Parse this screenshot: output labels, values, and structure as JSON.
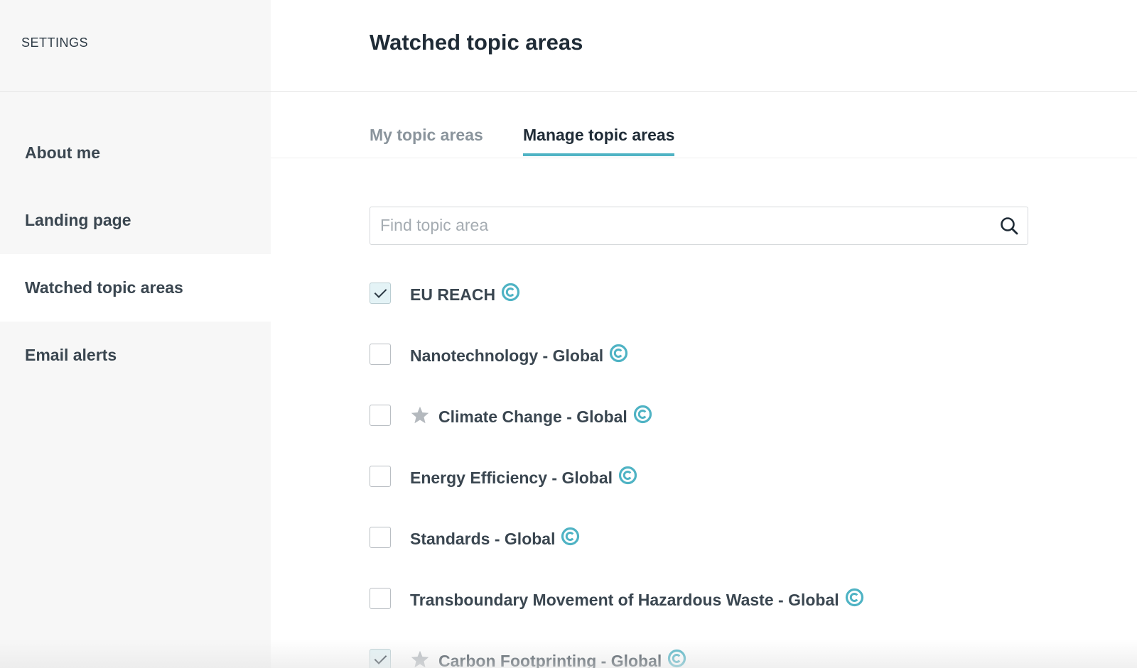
{
  "sidebar": {
    "header": "SETTINGS",
    "items": [
      {
        "label": "About me",
        "active": false
      },
      {
        "label": "Landing page",
        "active": false
      },
      {
        "label": "Watched topic areas",
        "active": true
      },
      {
        "label": "Email alerts",
        "active": false
      }
    ]
  },
  "main": {
    "title": "Watched topic areas",
    "tabs": [
      {
        "label": "My topic areas",
        "active": false
      },
      {
        "label": "Manage topic areas",
        "active": true
      }
    ],
    "search": {
      "placeholder": "Find topic area",
      "value": "",
      "icon": "search-icon"
    }
  },
  "topics": [
    {
      "label": "EU REACH",
      "checked": true,
      "starred": false,
      "badge_icon": "c-circle-icon"
    },
    {
      "label": "Nanotechnology - Global",
      "checked": false,
      "starred": false,
      "badge_icon": "c-circle-icon"
    },
    {
      "label": "Climate Change - Global",
      "checked": false,
      "starred": true,
      "badge_icon": "c-circle-icon"
    },
    {
      "label": "Energy Efficiency - Global",
      "checked": false,
      "starred": false,
      "badge_icon": "c-circle-icon"
    },
    {
      "label": "Standards - Global",
      "checked": false,
      "starred": false,
      "badge_icon": "c-circle-icon"
    },
    {
      "label": "Transboundary Movement of Hazardous Waste - Global",
      "checked": false,
      "starred": false,
      "badge_icon": "c-circle-icon"
    },
    {
      "label": "Carbon Footprinting - Global",
      "checked": true,
      "starred": true,
      "badge_icon": "c-circle-icon"
    }
  ],
  "colors": {
    "accent": "#4fb3c4",
    "sidebar_bg": "#f7f7f7",
    "text_dark": "#1f2b36",
    "text_muted": "#8a949c"
  }
}
